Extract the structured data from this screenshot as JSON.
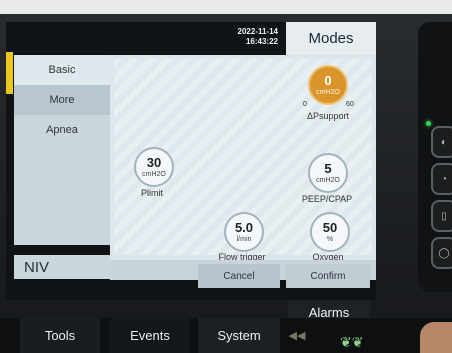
{
  "header": {
    "date": "2022-11-14",
    "time": "16:43:22",
    "modes_label": "Modes"
  },
  "sidebar": {
    "items": [
      {
        "label": "Basic"
      },
      {
        "label": "More"
      },
      {
        "label": "Apnea"
      }
    ]
  },
  "mode_name": "NIV",
  "params": {
    "psupport": {
      "value": "0",
      "unit": "cmH2O",
      "label": "ΔPsupport",
      "range_min": "0",
      "range_max": "60"
    },
    "plimit": {
      "value": "30",
      "unit": "cmH2O",
      "label": "Plimit"
    },
    "peep": {
      "value": "5",
      "unit": "cmH2O",
      "label": "PEEP/CPAP"
    },
    "flow_trigger": {
      "value": "5.0",
      "unit": "l/min",
      "label": "Flow trigger"
    },
    "oxygen": {
      "value": "50",
      "unit": "%",
      "label": "Oxygen"
    }
  },
  "buttons": {
    "cancel": "Cancel",
    "confirm": "Confirm",
    "alarms": "Alarms"
  },
  "nav": {
    "tools": "Tools",
    "events": "Events",
    "system": "System"
  },
  "colors": {
    "active_dial": "#d9952a",
    "led": "#39d45c",
    "panel": "#dce6eb"
  }
}
